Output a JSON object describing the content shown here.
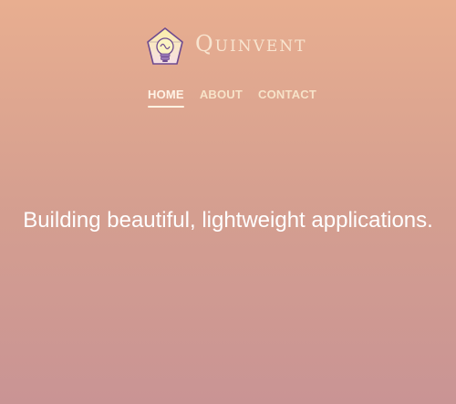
{
  "brand": {
    "name": "Quinvent"
  },
  "nav": {
    "items": [
      {
        "label": "HOME",
        "active": true
      },
      {
        "label": "ABOUT",
        "active": false
      },
      {
        "label": "CONTACT",
        "active": false
      }
    ]
  },
  "hero": {
    "tagline": "Building beautiful, lightweight applications."
  },
  "colors": {
    "gradient_top": "#e8ae90",
    "gradient_bottom": "#c99494",
    "nav_text": "#f7e3c9",
    "accent": "#ffffff"
  },
  "icons": {
    "logo": "lightbulb-in-diamond-icon"
  }
}
